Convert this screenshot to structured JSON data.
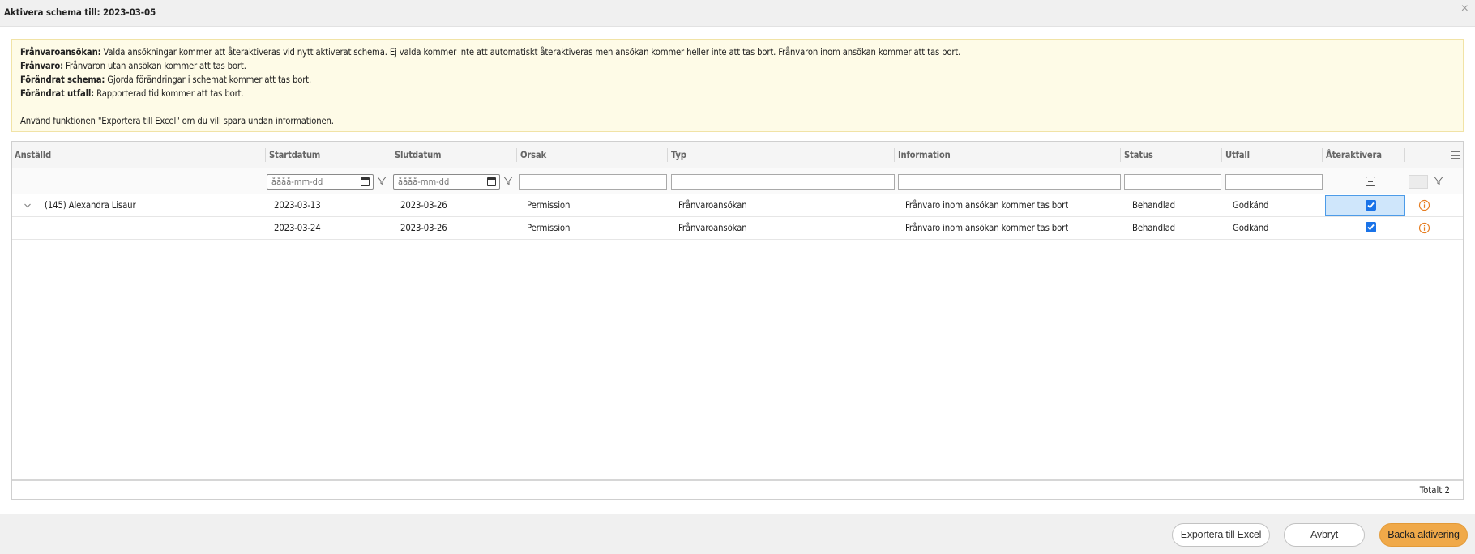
{
  "dialog": {
    "title": "Aktivera schema till: 2023-03-05",
    "close_symbol": "×"
  },
  "notice": {
    "lines": [
      {
        "label": "Frånvaroansökan:",
        "text": " Valda ansökningar kommer att återaktiveras vid nytt aktiverat schema. Ej valda kommer inte att automatiskt återaktiveras men ansökan kommer heller inte att tas bort. Frånvaron inom ansökan kommer att tas bort."
      },
      {
        "label": "Frånvaro:",
        "text": " Frånvaron utan ansökan kommer att tas bort."
      },
      {
        "label": "Förändrat schema:",
        "text": " Gjorda förändringar i schemat kommer att tas bort."
      },
      {
        "label": "Förändrat utfall:",
        "text": " Rapporterad tid kommer att tas bort."
      }
    ],
    "footer_text": "Använd funktionen \"Exportera till Excel\" om du vill spara undan informationen."
  },
  "grid": {
    "columns": {
      "employee": "Anställd",
      "start": "Startdatum",
      "end": "Slutdatum",
      "reason": "Orsak",
      "type": "Typ",
      "information": "Information",
      "status": "Status",
      "outcome": "Utfall",
      "reactivate": "Återaktivera"
    },
    "filters": {
      "date_placeholder": "åååå-mm-dd"
    },
    "group": {
      "employee": "(145) Alexandra Lisaur"
    },
    "rows": [
      {
        "start": "2023-03-13",
        "end": "2023-03-26",
        "reason": "Permission",
        "type": "Frånvaroansökan",
        "information": "Frånvaro inom ansökan kommer tas bort",
        "status": "Behandlad",
        "outcome": "Godkänd",
        "reactivate": true
      },
      {
        "start": "2023-03-24",
        "end": "2023-03-26",
        "reason": "Permission",
        "type": "Frånvaroansökan",
        "information": "Frånvaro inom ansökan kommer tas bort",
        "status": "Behandlad",
        "outcome": "Godkänd",
        "reactivate": true
      }
    ],
    "total_label": "Totalt 2"
  },
  "buttons": {
    "export": "Exportera till Excel",
    "cancel": "Avbryt",
    "rollback": "Backa aktivering"
  },
  "colors": {
    "primary_button": "#f0a949",
    "checkbox": "#1a73e8",
    "info_icon": "#e67e22",
    "notice_bg": "#fefbe7"
  }
}
